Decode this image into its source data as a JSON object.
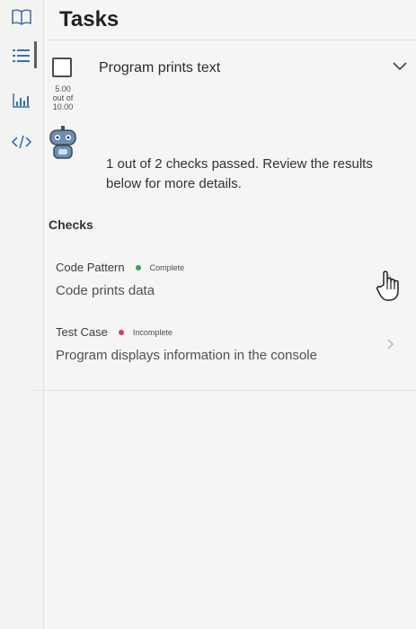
{
  "header": {
    "title": "Tasks"
  },
  "sidebar": {
    "items": [
      {
        "icon": "book-icon"
      },
      {
        "icon": "task-list-icon",
        "active": true
      },
      {
        "icon": "bar-chart-icon"
      },
      {
        "icon": "code-icon"
      }
    ]
  },
  "task": {
    "label": "Program prints text",
    "checked": false,
    "score": {
      "value": "5.00",
      "out_of_label": "out of",
      "max": "10.00"
    }
  },
  "result": {
    "message": "1 out of 2 checks passed. Review the results below for more details."
  },
  "checks": {
    "heading": "Checks",
    "items": [
      {
        "type": "Code Pattern",
        "status": "Complete",
        "status_color": "#3aa05a",
        "description": "Code prints data"
      },
      {
        "type": "Test Case",
        "status": "Incomplete",
        "status_color": "#d6386a",
        "description": "Program displays information in the console"
      }
    ]
  },
  "colors": {
    "active_indicator": "#5b5f63",
    "background": "#f5f6f4"
  }
}
